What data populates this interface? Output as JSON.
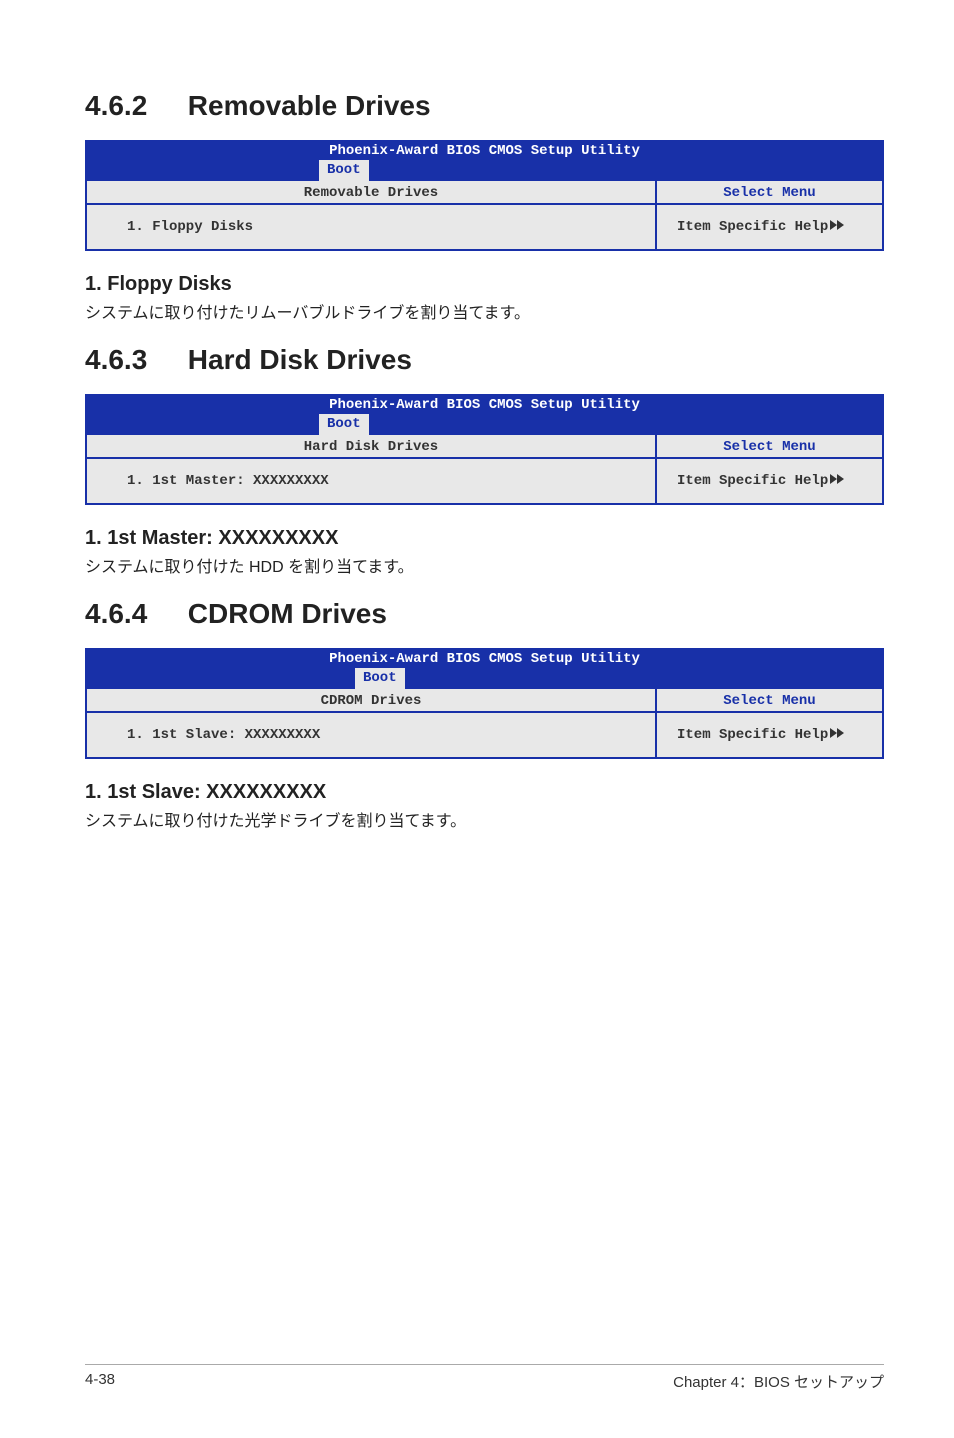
{
  "section_462": {
    "number": "4.6.2",
    "title": "Removable Drives",
    "bios": {
      "title": "Phoenix-Award BIOS CMOS Setup Utility",
      "tab": "Boot",
      "left_header": "Removable Drives",
      "right_header": "Select Menu",
      "item": "1. Floppy Disks",
      "help": "Item Specific Help"
    },
    "sub_heading": "1. Floppy Disks",
    "para": "システムに取り付けたリムーバブルドライブを割り当てます。"
  },
  "section_463": {
    "number": "4.6.3",
    "title": "Hard Disk Drives",
    "bios": {
      "title": "Phoenix-Award BIOS CMOS Setup Utility",
      "tab": "Boot",
      "left_header": "Hard Disk Drives",
      "right_header": "Select Menu",
      "item": "1. 1st Master: XXXXXXXXX",
      "help": "Item Specific Help"
    },
    "sub_heading": "1. 1st Master: XXXXXXXXX",
    "para": "システムに取り付けた HDD を割り当てます。"
  },
  "section_464": {
    "number": "4.6.4",
    "title": "CDROM Drives",
    "bios": {
      "title": "Phoenix-Award BIOS CMOS Setup Utility",
      "tab": "Boot",
      "left_header": "CDROM Drives",
      "right_header": "Select Menu",
      "item": "1. 1st Slave: XXXXXXXXX",
      "help": "Item Specific Help"
    },
    "sub_heading": "1. 1st Slave: XXXXXXXXX",
    "para": "システムに取り付けた光学ドライブを割り当てます。"
  },
  "footer": {
    "left": "4-38",
    "right": "Chapter 4：BIOS セットアップ"
  }
}
